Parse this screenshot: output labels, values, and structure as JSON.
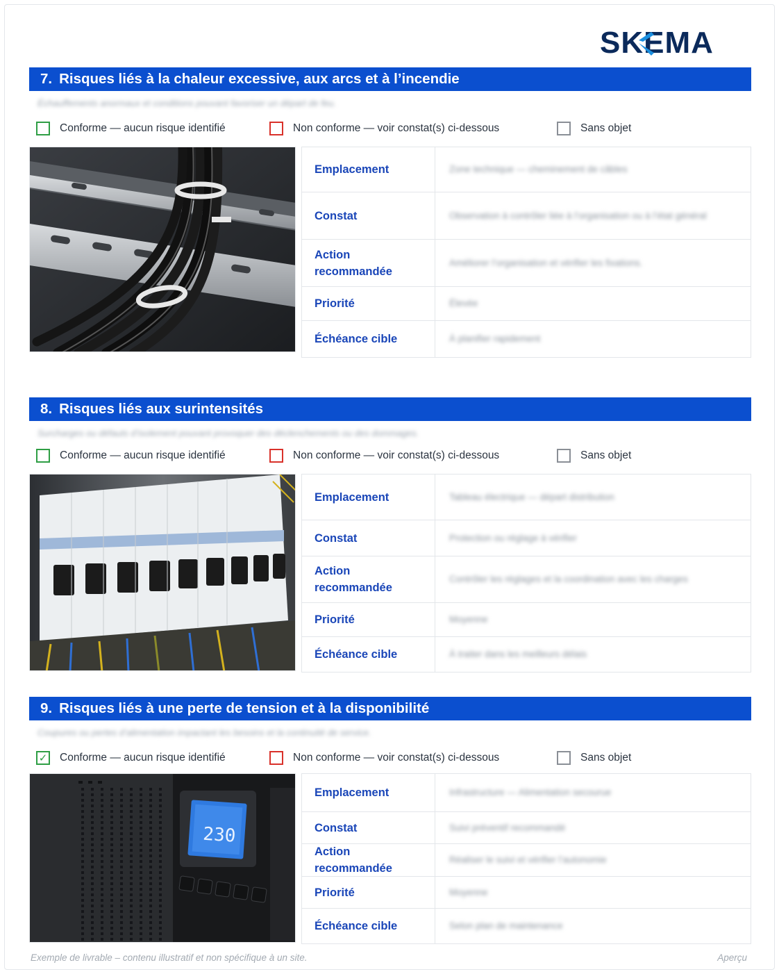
{
  "brand": {
    "name": "SKEMA",
    "color": "#0b2a5b",
    "accent": "#1a8fe0"
  },
  "colors": {
    "header_bg": "#0b4fcf",
    "label": "#1a46b8",
    "ok": "#2e9e44",
    "nok": "#d9312a"
  },
  "status_labels": {
    "conforme": "Conforme — aucun risque identifié",
    "non_conforme": "Non conforme — voir constat(s) ci-dessous",
    "sans_objet": "Sans objet"
  },
  "field_labels": {
    "emplacement": "Emplacement",
    "constat": "Constat",
    "action": "Action recommandée",
    "priorite": "Priorité",
    "echeance": "Échéance cible"
  },
  "sections": [
    {
      "number": "7.",
      "title": "Risques liés à la chaleur excessive, aux arcs et à l’incendie",
      "subtitle": "Échauffements anormaux et conditions pouvant favoriser un départ de feu.",
      "checked": "",
      "photo_icon": "cable-tray-photo",
      "values": {
        "emplacement": "Zone technique — cheminement de câbles",
        "constat": "Observation à contrôler liée à l’organisation ou à l’état général",
        "action": "Améliorer l’organisation et vérifier les fixations.",
        "priorite": "Élevée",
        "echeance": "À planifier rapidement"
      }
    },
    {
      "number": "8.",
      "title": "Risques liés aux surintensités",
      "subtitle": "Surcharges ou défauts d’isolement pouvant provoquer des déclenchements ou des dommages.",
      "checked": "",
      "photo_icon": "breaker-panel-photo",
      "values": {
        "emplacement": "Tableau électrique — départ distribution",
        "constat": "Protection ou réglage à vérifier",
        "action": "Contrôler les réglages et la coordination avec les charges",
        "priorite": "Moyenne",
        "echeance": "À traiter dans les meilleurs délais"
      }
    },
    {
      "number": "9.",
      "title": "Risques liés à une perte de tension et à la disponibilité",
      "subtitle": "Coupures ou pertes d’alimentation impactant les besoins et la continuité de service.",
      "checked": "conforme",
      "photo_icon": "ups-photo",
      "values": {
        "emplacement": "Infrastructure — Alimentation secourue",
        "constat": "Suivi préventif recommandé",
        "action": "Réaliser le suivi et vérifier l’autonomie",
        "priorite": "Moyenne",
        "echeance": "Selon plan de maintenance"
      }
    }
  ],
  "ups_display": "230",
  "footer": {
    "note": "Exemple de livrable – contenu illustratif et non spécifique à un site.",
    "tag": "Aperçu"
  }
}
